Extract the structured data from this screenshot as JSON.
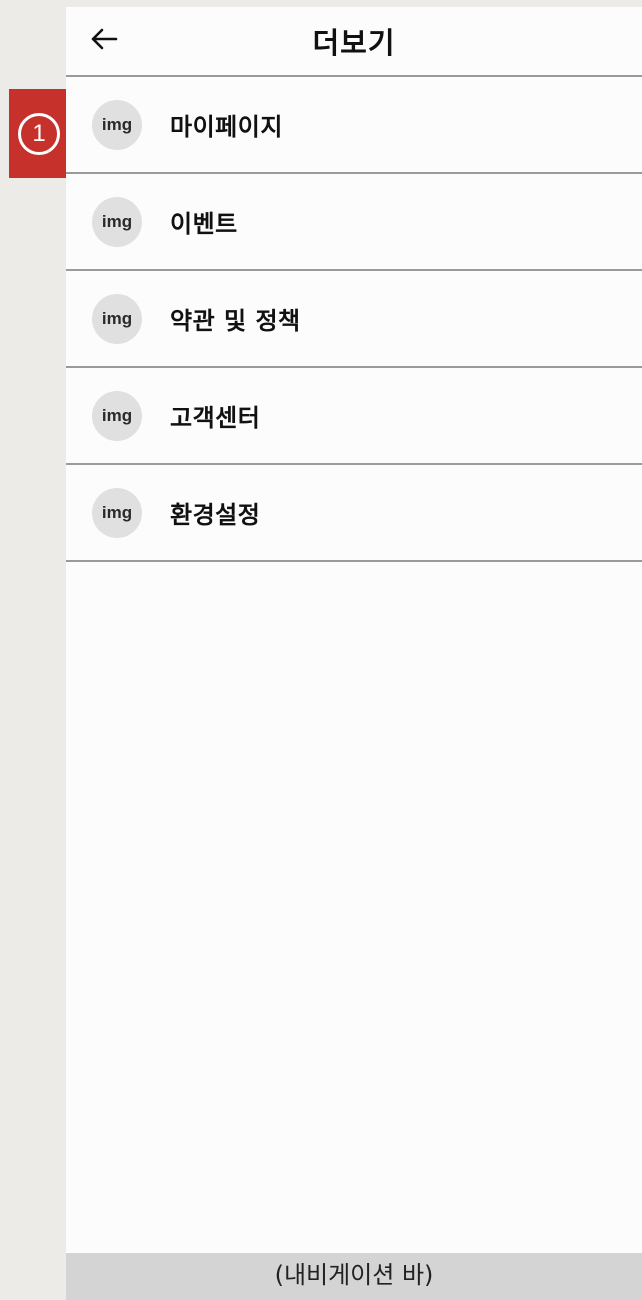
{
  "header": {
    "back_icon": "arrow-left-icon",
    "title": "더보기"
  },
  "menu": {
    "items": [
      {
        "icon_text": "img",
        "label": "마이페이지"
      },
      {
        "icon_text": "img",
        "label": "이벤트"
      },
      {
        "icon_text": "img",
        "label": "약관 및 정책"
      },
      {
        "icon_text": "img",
        "label": "고객센터"
      },
      {
        "icon_text": "img",
        "label": "환경설정"
      }
    ]
  },
  "navbar": {
    "label": "(내비게이션 바)"
  },
  "annotation": {
    "marker_number": "1",
    "color": "#c6312b"
  }
}
